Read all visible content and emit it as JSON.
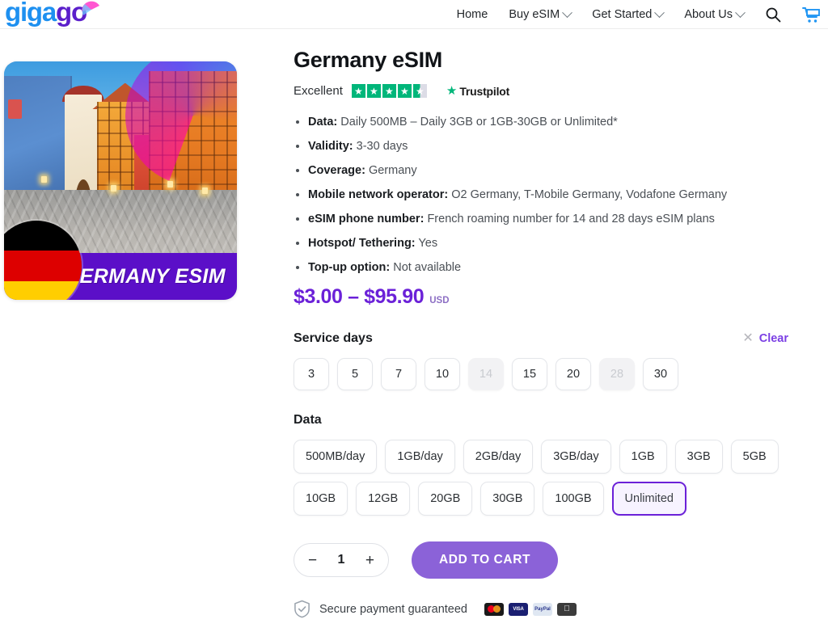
{
  "header": {
    "logo": {
      "part1": "giga",
      "part2": "go"
    },
    "nav": [
      {
        "label": "Home",
        "has_caret": false
      },
      {
        "label": "Buy eSIM",
        "has_caret": true
      },
      {
        "label": "Get Started",
        "has_caret": true
      },
      {
        "label": "About Us",
        "has_caret": true
      }
    ],
    "search_icon": "search-icon",
    "cart_icon": "shopping-cart-icon"
  },
  "product": {
    "image_alt": "Germany eSIM product image - German old town street",
    "banner_text": "GERMANY ESIM",
    "flag": "german-flag"
  },
  "detail": {
    "title": "Germany eSIM",
    "rating": {
      "label": "Excellent",
      "stars": 4.5,
      "brand": "Trustpilot",
      "star_color": "#00B67A"
    },
    "specs": [
      {
        "label": "Data:",
        "value": "Daily 500MB – Daily 3GB or 1GB-30GB or Unlimited*"
      },
      {
        "label": "Validity:",
        "value": "3-30 days"
      },
      {
        "label": "Coverage:",
        "value": "Germany"
      },
      {
        "label": "Mobile network operator:",
        "value": "O2 Germany, T-Mobile Germany, Vodafone Germany"
      },
      {
        "label": "eSIM phone number:",
        "value": "French roaming number for 14 and 28 days eSIM plans"
      },
      {
        "label": "Hotspot/ Tethering:",
        "value": "Yes"
      },
      {
        "label": "Top-up option:",
        "value": "Not available"
      }
    ],
    "price": {
      "range": "$3.00 – $95.90",
      "currency": "USD",
      "color": "#6B21D8"
    }
  },
  "service_days": {
    "title": "Service days",
    "clear_label": "Clear",
    "clear_icon": "close-icon",
    "options": [
      {
        "label": "3",
        "disabled": false,
        "selected": false
      },
      {
        "label": "5",
        "disabled": false,
        "selected": false
      },
      {
        "label": "7",
        "disabled": false,
        "selected": false
      },
      {
        "label": "10",
        "disabled": false,
        "selected": false
      },
      {
        "label": "14",
        "disabled": true,
        "selected": false
      },
      {
        "label": "15",
        "disabled": false,
        "selected": false
      },
      {
        "label": "20",
        "disabled": false,
        "selected": false
      },
      {
        "label": "28",
        "disabled": true,
        "selected": false
      },
      {
        "label": "30",
        "disabled": false,
        "selected": false
      }
    ]
  },
  "data_section": {
    "title": "Data",
    "options": [
      {
        "label": "500MB/day",
        "disabled": false,
        "selected": false
      },
      {
        "label": "1GB/day",
        "disabled": false,
        "selected": false
      },
      {
        "label": "2GB/day",
        "disabled": false,
        "selected": false
      },
      {
        "label": "3GB/day",
        "disabled": false,
        "selected": false
      },
      {
        "label": "1GB",
        "disabled": false,
        "selected": false
      },
      {
        "label": "3GB",
        "disabled": false,
        "selected": false
      },
      {
        "label": "5GB",
        "disabled": false,
        "selected": false
      },
      {
        "label": "10GB",
        "disabled": false,
        "selected": false
      },
      {
        "label": "12GB",
        "disabled": false,
        "selected": false
      },
      {
        "label": "20GB",
        "disabled": false,
        "selected": false
      },
      {
        "label": "30GB",
        "disabled": false,
        "selected": false
      },
      {
        "label": "100GB",
        "disabled": false,
        "selected": false
      },
      {
        "label": "Unlimited",
        "disabled": false,
        "selected": true
      }
    ],
    "selected_color": "#6B21D8"
  },
  "purchase": {
    "decrement": "−",
    "quantity": "1",
    "increment": "+",
    "add_to_cart": "ADD TO CART",
    "button_color": "#8B62D8"
  },
  "secure": {
    "icon": "shield-check-icon",
    "text": "Secure payment guaranteed",
    "methods": [
      {
        "name": "mastercard",
        "label": ""
      },
      {
        "name": "visa",
        "label": "VISA"
      },
      {
        "name": "paypal",
        "label": "PayPal"
      },
      {
        "name": "apple-pay",
        "label": ""
      }
    ]
  }
}
